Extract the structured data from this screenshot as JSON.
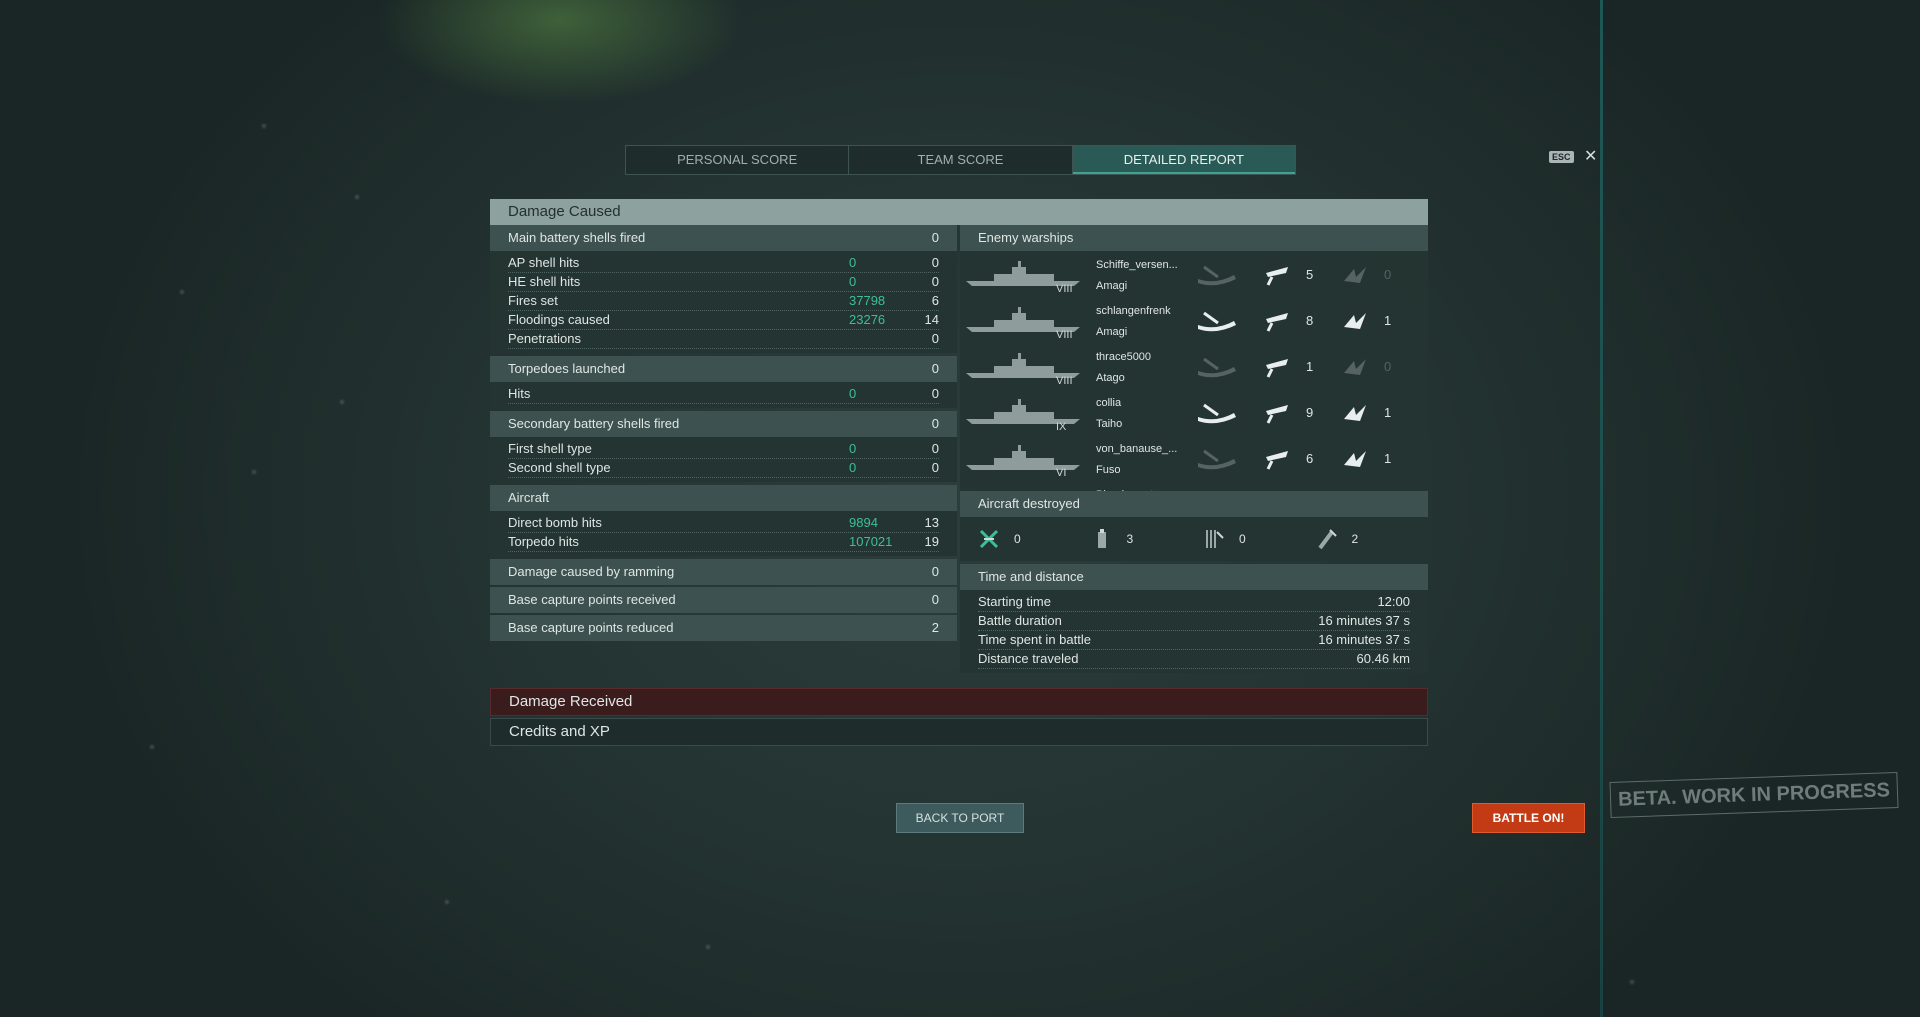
{
  "tabs": {
    "personal": "PERSONAL SCORE",
    "team": "TEAM SCORE",
    "detailed": "DETAILED REPORT"
  },
  "esc_label": "ESC",
  "close_glyph": "✕",
  "damage_caused": {
    "title": "Damage Caused",
    "main_battery": {
      "label": "Main battery shells fired",
      "value": "0",
      "rows": [
        {
          "label": "AP shell hits",
          "damage": "0",
          "count": "0"
        },
        {
          "label": "HE shell hits",
          "damage": "0",
          "count": "0"
        },
        {
          "label": "Fires set",
          "damage": "37798",
          "count": "6"
        },
        {
          "label": "Floodings caused",
          "damage": "23276",
          "count": "14"
        },
        {
          "label": "Penetrations",
          "damage": "",
          "count": "0"
        }
      ]
    },
    "torpedoes": {
      "label": "Torpedoes launched",
      "value": "0",
      "rows": [
        {
          "label": "Hits",
          "damage": "0",
          "count": "0"
        }
      ]
    },
    "secondary": {
      "label": "Secondary battery shells fired",
      "value": "0",
      "rows": [
        {
          "label": "First shell type",
          "damage": "0",
          "count": "0"
        },
        {
          "label": "Second shell type",
          "damage": "0",
          "count": "0"
        }
      ]
    },
    "aircraft": {
      "label": "Aircraft",
      "rows": [
        {
          "label": "Direct bomb hits",
          "damage": "9894",
          "count": "13"
        },
        {
          "label": "Torpedo hits",
          "damage": "107021",
          "count": "19"
        }
      ]
    },
    "ramming": {
      "label": "Damage caused by ramming",
      "value": "0"
    },
    "capture_received": {
      "label": "Base capture points received",
      "value": "0"
    },
    "capture_reduced": {
      "label": "Base capture points reduced",
      "value": "2"
    }
  },
  "enemy": {
    "title": "Enemy warships",
    "ships": [
      {
        "player": "Schiffe_versen...",
        "ship": "Amagi",
        "tier": "VIII",
        "bomb": "5",
        "torp": "0"
      },
      {
        "player": "schlangenfrenk",
        "ship": "Amagi",
        "tier": "VIII",
        "bomb": "8",
        "torp": "1"
      },
      {
        "player": "thrace5000",
        "ship": "Atago",
        "tier": "VIII",
        "bomb": "1",
        "torp": "0"
      },
      {
        "player": "collia",
        "ship": "Taiho",
        "tier": "IX",
        "bomb": "9",
        "torp": "1"
      },
      {
        "player": "von_banause_...",
        "ship": "Fuso",
        "tier": "VI",
        "bomb": "6",
        "torp": "1"
      },
      {
        "player": "Bloodymaster",
        "ship": "",
        "tier": "",
        "bomb": "",
        "torp": ""
      }
    ]
  },
  "aircraft_destroyed": {
    "title": "Aircraft destroyed",
    "items": [
      {
        "icon": "plane-destroyed-icon",
        "value": "0"
      },
      {
        "icon": "fighter-squadron-icon",
        "value": "3"
      },
      {
        "icon": "torpedo-bomber-icon",
        "value": "0"
      },
      {
        "icon": "dive-bomber-icon",
        "value": "2"
      }
    ]
  },
  "time": {
    "title": "Time and distance",
    "rows": [
      {
        "label": "Starting time",
        "value": "12:00"
      },
      {
        "label": "Battle duration",
        "value": "16 minutes 37 s"
      },
      {
        "label": "Time spent in battle",
        "value": "16 minutes 37 s"
      },
      {
        "label": "Distance traveled",
        "value": "60.46 km"
      }
    ]
  },
  "damage_received": "Damage Received",
  "credits_xp": "Credits and XP",
  "back_to_port": "BACK TO PORT",
  "battle_on": "BATTLE ON!",
  "beta": "BETA. WORK IN PROGRESS",
  "colors": {
    "accent": "#3bbf9a",
    "battle": "#c23b15",
    "header": "#8da19f"
  }
}
